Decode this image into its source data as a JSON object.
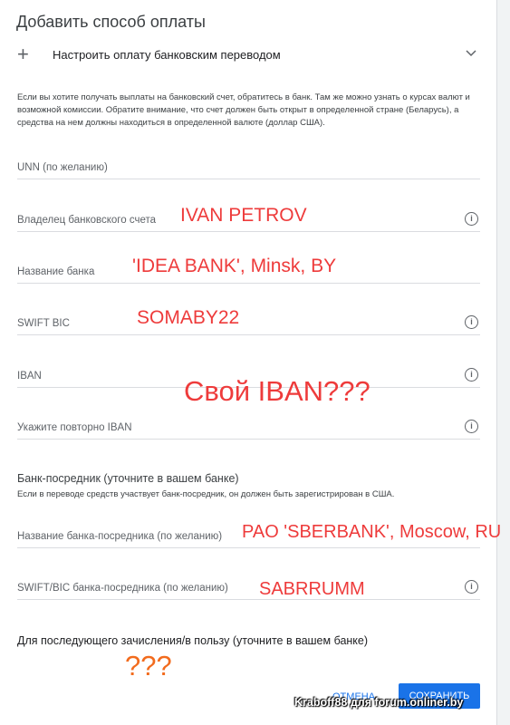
{
  "header": {
    "title": "Добавить способ оплаты"
  },
  "section": {
    "label": "Настроить оплату банковским переводом",
    "plus": "+",
    "expand_icon": "chevron-down-icon"
  },
  "description": "Если вы хотите получать выплаты на банковский счет, обратитесь в банк. Там же можно узнать о курсах валют и возможной комиссии. Обратите внимание, что счет должен быть открыт в определенной стране (Беларусь), а средства на нем должны находиться в определенной валюте (доллар США).",
  "fields": {
    "unn": {
      "label": "UNN (по желанию)"
    },
    "owner": {
      "label": "Владелец банковского счета",
      "info_icon": "info-icon"
    },
    "bank_name": {
      "label": "Название банка"
    },
    "swift": {
      "label": "SWIFT BIC",
      "info_icon": "info-icon"
    },
    "iban": {
      "label": "IBAN",
      "info_icon": "info-icon"
    },
    "iban_repeat": {
      "label": "Укажите повторно IBAN",
      "info_icon": "info-icon"
    },
    "intermediary_name": {
      "label": "Название банка-посредника (по желанию)"
    },
    "intermediary_swift": {
      "label": "SWIFT/BIC банка-посредника (по желанию)",
      "info_icon": "info-icon"
    }
  },
  "intermediary": {
    "heading": "Банк-посредник (уточните в вашем банке)",
    "note": "Если в переводе средств участвует банк-посредник, он должен быть зарегистрирован в США."
  },
  "further_credit": {
    "label": "Для последующего зачисления/в пользу (уточните в вашем банке)"
  },
  "handwritten": {
    "owner": "IVAN PETROV",
    "bank": "'IDEA BANK', Minsk, BY",
    "swift": "SOMABY22",
    "iban_question": "Свой IBAN???",
    "intermediary_bank": "PAO 'SBERBANK', Moscow, RU",
    "intermediary_swift": "SABRRUMM",
    "further_credit": "???"
  },
  "actions": {
    "cancel": "ОТМЕНА",
    "save": "СОХРАНИТЬ"
  },
  "watermark": "Kraboff88 для forum.onliner.by",
  "colors": {
    "accent": "#1a73e8",
    "annotation_red": "#ee3b3b",
    "annotation_orange": "#f26b1d"
  }
}
